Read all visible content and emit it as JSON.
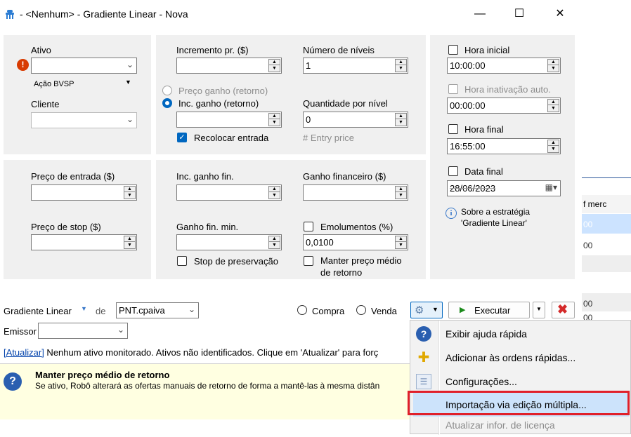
{
  "window": {
    "title": "- <Nenhum> - Gradiente Linear - Nova",
    "minimize": "—",
    "maximize": "☐",
    "close": "✕"
  },
  "left_panel": {
    "ativo_label": "Ativo",
    "ativo_value": "",
    "ativo_type": "Ação BVSP",
    "cliente_label": "Cliente",
    "cliente_value": "",
    "preco_entrada_label": "Preço de entrada ($)",
    "preco_entrada_value": "",
    "preco_stop_label": "Preço de stop ($)",
    "preco_stop_value": ""
  },
  "mid_panel": {
    "incremento_label": "Incremento pr. ($)",
    "incremento_value": "",
    "numero_niveis_label": "Número de níveis",
    "numero_niveis_value": "1",
    "preco_ganho_label": "Preço ganho (retorno)",
    "inc_ganho_label": "Inc. ganho (retorno)",
    "inc_ganho_value": "",
    "quantidade_label": "Quantidade por nível",
    "quantidade_value": "0",
    "entry_price_hint": "# Entry price",
    "recolocar_label": "Recolocar entrada",
    "inc_ganho_fin_label": "Inc. ganho fin.",
    "inc_ganho_fin_value": "",
    "ganho_financeiro_label": "Ganho financeiro ($)",
    "ganho_financeiro_value": "",
    "ganho_fin_min_label": "Ganho fin. min.",
    "ganho_fin_min_value": "",
    "emolumentos_label": "Emolumentos (%)",
    "emolumentos_value": "0,0100",
    "stop_preservacao_label": "Stop de preservação",
    "manter_preco_label_1": "Manter preço médio",
    "manter_preco_label_2": "de retorno"
  },
  "right_panel": {
    "hora_inicial_label": "Hora inicial",
    "hora_inicial_value": "10:00:00",
    "hora_inativacao_label": "Hora inativação auto.",
    "hora_inativacao_value": "00:00:00",
    "hora_final_label": "Hora final",
    "hora_final_value": "16:55:00",
    "data_final_label": "Data final",
    "data_final_value": "28/06/2023",
    "sobre_label_1": "Sobre a estratégia",
    "sobre_label_2": "'Gradiente Linear'"
  },
  "bottom": {
    "strategy_label": "Gradiente Linear",
    "de_label": "de",
    "account_value": "PNT.cpaiva",
    "compra_label": "Compra",
    "venda_label": "Venda",
    "executar_label": "Executar",
    "emissor_label": "Emissor",
    "emissor_value": "",
    "status_link": "[Atualizar]",
    "status_text": " Nenhum ativo monitorado. Ativos não identificados. Clique em 'Atualizar' para forç",
    "info_title": "Manter preço médio de retorno",
    "info_text": "Se ativo, Robô alterará as ofertas manuais de retorno de forma a mantê-las à mesma distân"
  },
  "menu": {
    "items": [
      {
        "label": "Exibir ajuda rápida",
        "icon": "help-icon"
      },
      {
        "label": "Adicionar às ordens rápidas...",
        "icon": "add-star-icon"
      },
      {
        "label": "Configurações...",
        "icon": "settings-list-icon"
      },
      {
        "label": "Importação via edição múltipla...",
        "icon": "",
        "highlighted": true
      },
      {
        "label": "Atualizar infor. de licença",
        "icon": "",
        "disabled": true
      }
    ]
  },
  "background_app": {
    "header": "f merc",
    "row1": "00",
    "row2": "00",
    "row3": "00",
    "row4": "00"
  },
  "colors": {
    "accent": "#0067c0",
    "panel": "#f0f0f0",
    "highlight_box": "#e0202a",
    "info_bg": "#ffffe1"
  }
}
